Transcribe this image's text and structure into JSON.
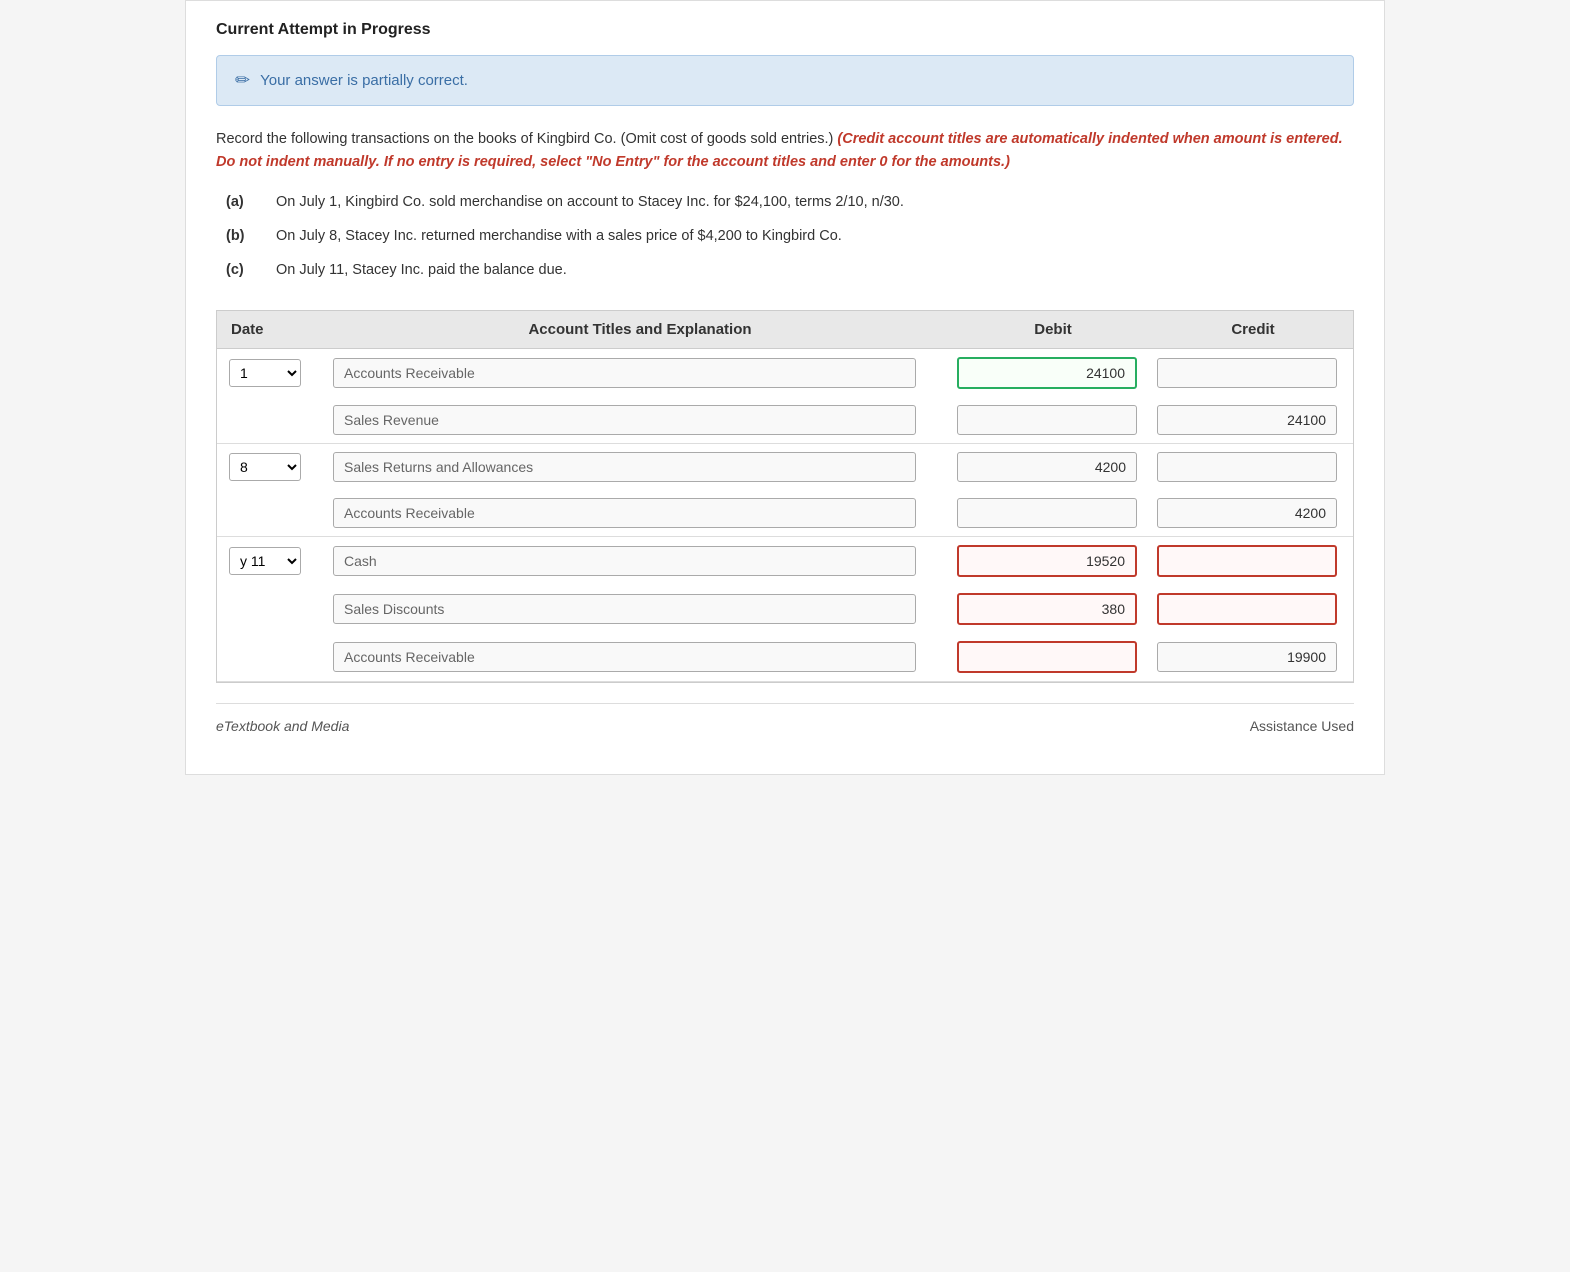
{
  "page": {
    "section_title": "Current Attempt in Progress",
    "alert_message": "Your answer is partially correct.",
    "alert_icon": "✏",
    "instructions_plain": "Record the following transactions on the books of Kingbird Co. (Omit cost of goods sold entries.)",
    "instructions_italic": "(Credit account titles are automatically indented when amount is entered. Do not indent manually. If no entry is required, select \"No Entry\" for the account titles and enter 0 for the amounts.)",
    "transactions": [
      {
        "label": "(a)",
        "text": "On July 1, Kingbird Co. sold merchandise on account to Stacey Inc. for $24,100, terms 2/10, n/30."
      },
      {
        "label": "(b)",
        "text": "On July 8, Stacey Inc. returned merchandise with a sales price of $4,200 to Kingbird Co."
      },
      {
        "label": "(c)",
        "text": "On July 11, Stacey Inc. paid the balance due."
      }
    ],
    "table": {
      "headers": {
        "date": "Date",
        "account": "Account Titles and Explanation",
        "debit": "Debit",
        "credit": "Credit"
      },
      "entry_groups": [
        {
          "id": "group-a",
          "date_value": "1",
          "rows": [
            {
              "account_placeholder": "Accounts Receivable",
              "debit_value": "24100",
              "credit_value": "",
              "debit_border": "green",
              "credit_border": "normal"
            },
            {
              "account_placeholder": "Sales Revenue",
              "debit_value": "",
              "credit_value": "24100",
              "debit_border": "normal",
              "credit_border": "normal"
            }
          ]
        },
        {
          "id": "group-b",
          "date_value": "8",
          "rows": [
            {
              "account_placeholder": "Sales Returns and Allowances",
              "debit_value": "4200",
              "credit_value": "",
              "debit_border": "normal",
              "credit_border": "normal"
            },
            {
              "account_placeholder": "Accounts Receivable",
              "debit_value": "",
              "credit_value": "4200",
              "debit_border": "normal",
              "credit_border": "normal"
            }
          ]
        },
        {
          "id": "group-c",
          "date_value": "y 11",
          "rows": [
            {
              "account_placeholder": "Cash",
              "debit_value": "19520",
              "credit_value": "",
              "debit_border": "red",
              "credit_border": "red"
            },
            {
              "account_placeholder": "Sales Discounts",
              "debit_value": "380",
              "credit_value": "",
              "debit_border": "red",
              "credit_border": "red"
            },
            {
              "account_placeholder": "Accounts Receivable",
              "debit_value": "",
              "credit_value": "19900",
              "debit_border": "red",
              "credit_border": "normal"
            }
          ]
        }
      ]
    },
    "bottom_left": "eTextbook and Media",
    "bottom_right": "Assistance Used"
  }
}
